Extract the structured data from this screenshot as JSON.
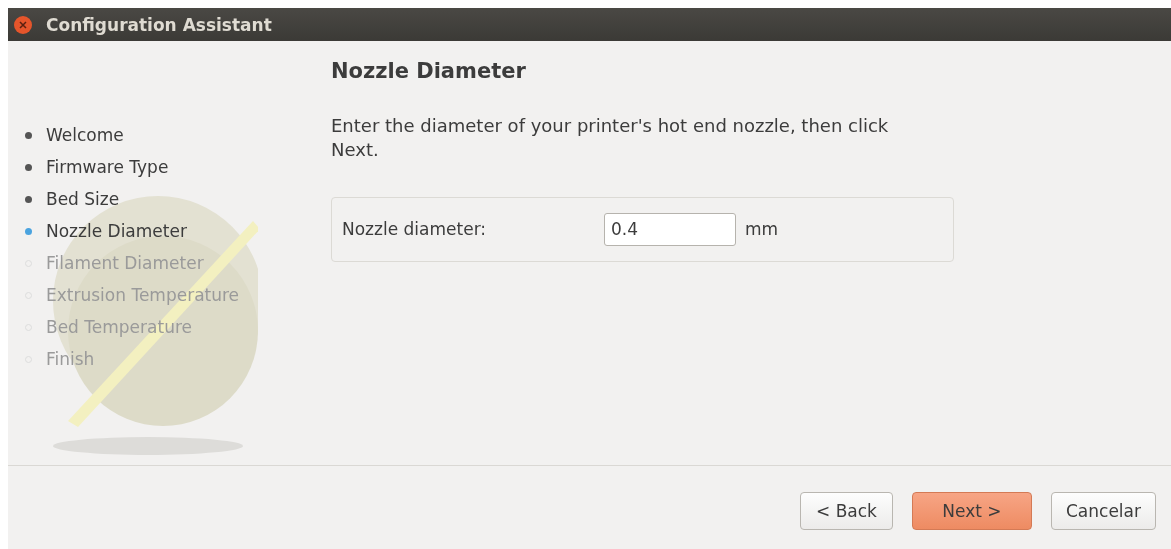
{
  "window": {
    "title": "Configuration Assistant"
  },
  "steps": [
    {
      "label": "Welcome",
      "done": true,
      "selected": false
    },
    {
      "label": "Firmware Type",
      "done": true,
      "selected": false
    },
    {
      "label": "Bed Size",
      "done": true,
      "selected": false
    },
    {
      "label": "Nozzle Diameter",
      "done": false,
      "selected": true
    },
    {
      "label": "Filament Diameter",
      "done": false,
      "selected": false
    },
    {
      "label": "Extrusion Temperature",
      "done": false,
      "selected": false
    },
    {
      "label": "Bed Temperature",
      "done": false,
      "selected": false
    },
    {
      "label": "Finish",
      "done": false,
      "selected": false
    }
  ],
  "page": {
    "title": "Nozzle Diameter",
    "description": "Enter the diameter of your printer's hot end nozzle, then click Next.",
    "field": {
      "label": "Nozzle diameter:",
      "value": "0.4",
      "unit": "mm"
    }
  },
  "buttons": [
    {
      "label": "< Back",
      "kind": "normal"
    },
    {
      "label": "Next >",
      "kind": "default"
    },
    {
      "label": "Cancelar",
      "kind": "normal"
    }
  ]
}
